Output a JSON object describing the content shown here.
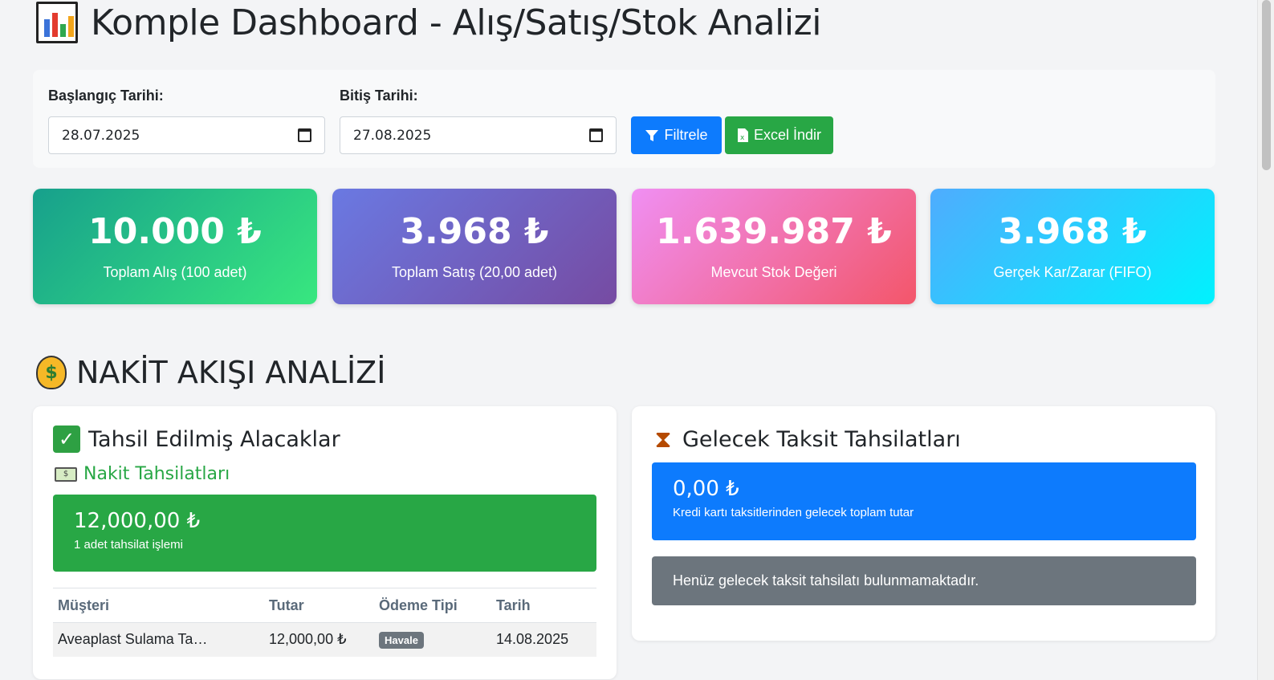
{
  "header": {
    "title": "Komple Dashboard - Alış/Satış/Stok Analizi",
    "icon": "bar-chart-icon"
  },
  "filters": {
    "start_label": "Başlangıç Tarihi:",
    "start_value": "28.07.2025",
    "end_label": "Bitiş Tarihi:",
    "end_value": "27.08.2025",
    "filter_button": "Filtrele",
    "excel_button": "Excel İndir"
  },
  "stats": [
    {
      "value": "10.000 ₺",
      "label": "Toplam Alış (100 adet)"
    },
    {
      "value": "3.968 ₺",
      "label": "Toplam Satış (20,00 adet)"
    },
    {
      "value": "1.639.987 ₺",
      "label": "Mevcut Stok Değeri"
    },
    {
      "value": "3.968 ₺",
      "label": "Gerçek Kar/Zarar (FIFO)"
    }
  ],
  "cashflow": {
    "title": "NAKİT AKIŞI ANALİZİ",
    "collected": {
      "title": "Tahsil Edilmiş Alacaklar",
      "cash_title": "Nakit Tahsilatları",
      "amount": "12,000,00 ₺",
      "count_text": "1 adet tahsilat işlemi",
      "columns": [
        "Müşteri",
        "Tutar",
        "Ödeme Tipi",
        "Tarih"
      ],
      "rows": [
        {
          "customer": "Aveaplast Sulama Ta…",
          "amount": "12,000,00 ₺",
          "type": "Havale",
          "date": "14.08.2025"
        }
      ]
    },
    "future": {
      "title": "Gelecek Taksit Tahsilatları",
      "amount": "0,00 ₺",
      "desc": "Kredi kartı taksitlerinden gelecek toplam tutar",
      "empty_text": "Henüz gelecek taksit tahsilatı bulunmamaktadır."
    }
  },
  "colors": {
    "primary": "#0d7bfd",
    "success": "#28a745",
    "secondary": "#6c757d"
  }
}
